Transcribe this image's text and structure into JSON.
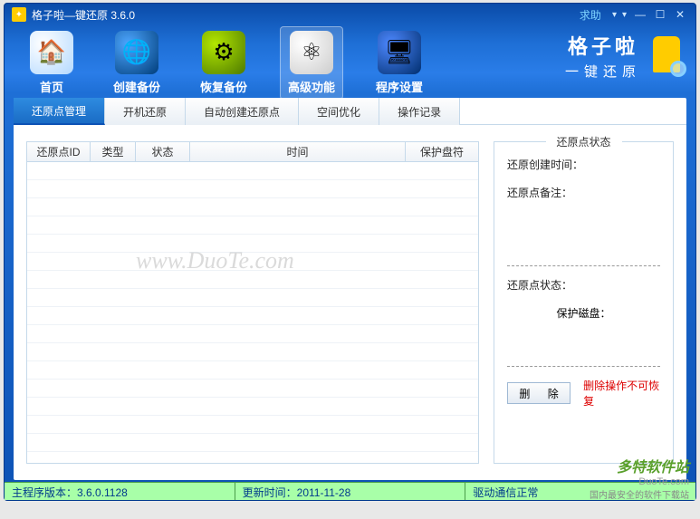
{
  "titlebar": {
    "title": "格子啦—键还原 3.6.0",
    "help": "求助"
  },
  "brand": {
    "name": "格子啦",
    "sub": "一键还原"
  },
  "main_nav": [
    {
      "key": "home",
      "label": "首页",
      "glyph": "🏠"
    },
    {
      "key": "create",
      "label": "创建备份",
      "glyph": "🌐"
    },
    {
      "key": "restore",
      "label": "恢复备份",
      "glyph": "⚙"
    },
    {
      "key": "advanced",
      "label": "高级功能",
      "glyph": "⚛",
      "active": true
    },
    {
      "key": "settings",
      "label": "程序设置",
      "glyph": "🖥"
    }
  ],
  "subtabs": [
    {
      "label": "还原点管理",
      "active": true
    },
    {
      "label": "开机还原"
    },
    {
      "label": "自动创建还原点"
    },
    {
      "label": "空间优化"
    },
    {
      "label": "操作记录"
    }
  ],
  "table": {
    "columns": {
      "id": "还原点ID",
      "type": "类型",
      "state": "状态",
      "time": "时间",
      "disk": "保护盘符"
    },
    "rows": []
  },
  "side": {
    "legend": "还原点状态",
    "created_label": "还原创建时间：",
    "created_value": "",
    "remark_label": "还原点备注：",
    "remark_value": "",
    "state_label": "还原点状态：",
    "state_value": "",
    "protect_disk_label": "保护磁盘：",
    "protect_disk_value": "",
    "delete_btn": "删 除",
    "warn": "删除操作不可恢复"
  },
  "statusbar": {
    "version": "主程序版本：3.6.0.1128",
    "updated": "更新时间：2011-11-28",
    "driver": "驱动通信正常"
  },
  "watermark": {
    "main": "www.DuoTe.com",
    "logo": "多特软件站",
    "domain": "DuoTe.com",
    "slogan": "国内最安全的软件下载站"
  }
}
